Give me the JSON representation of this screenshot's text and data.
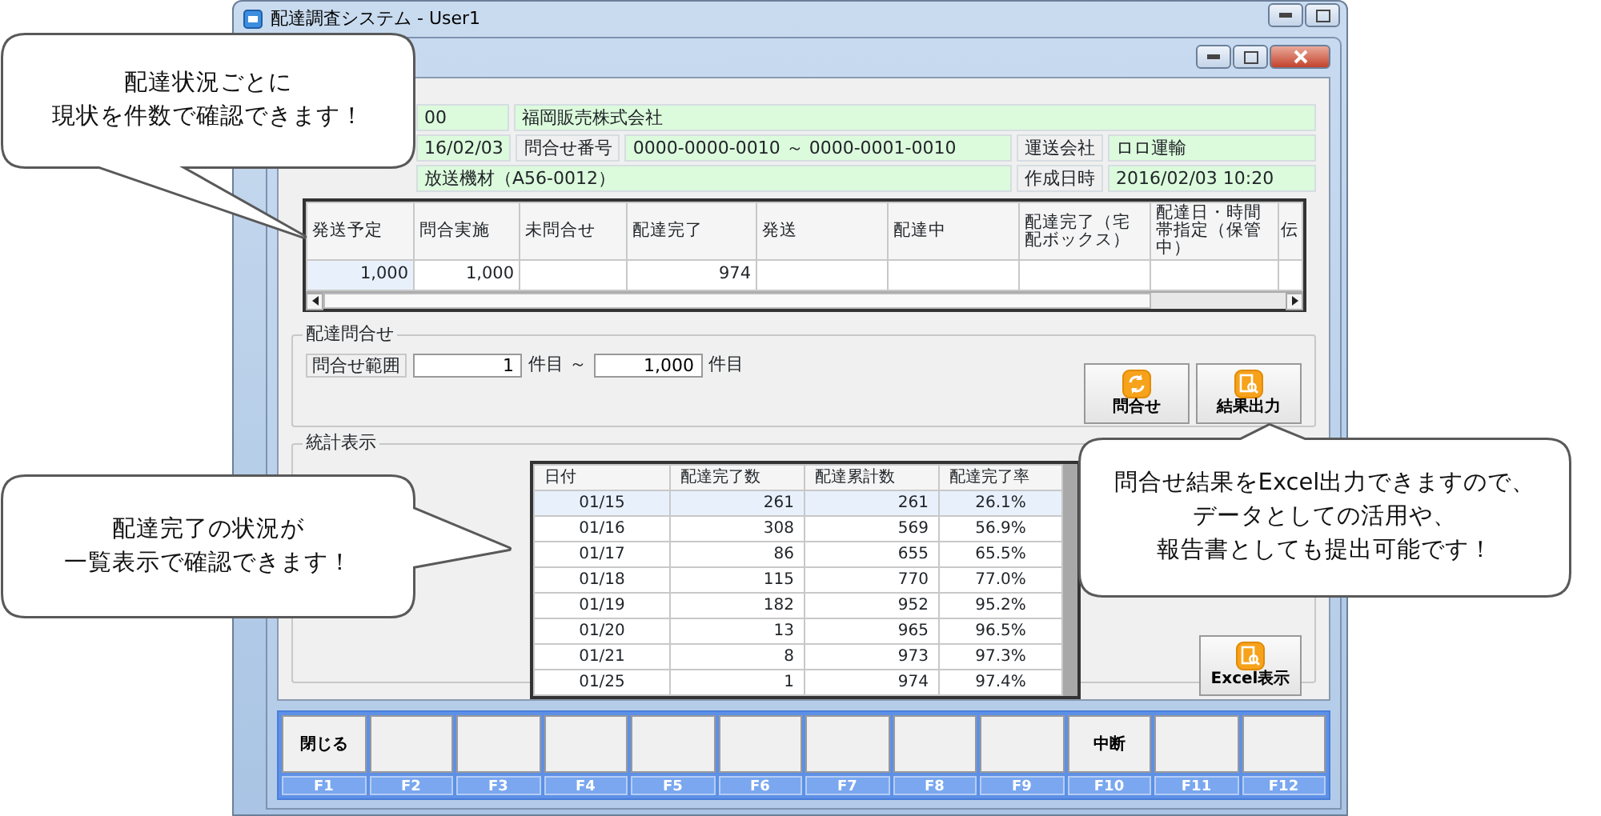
{
  "window": {
    "title": "配達調査システム - User1"
  },
  "info_rows": [
    {
      "cells": [
        {
          "kind": "value",
          "text": "00"
        },
        {
          "kind": "value",
          "text": "福岡販売株式会社"
        }
      ]
    },
    {
      "cells": [
        {
          "kind": "value",
          "text": "16/02/03"
        },
        {
          "kind": "label",
          "text": "問合せ番号"
        },
        {
          "kind": "value",
          "text": "0000-0000-0010 ～ 0000-0001-0010"
        },
        {
          "kind": "label",
          "text": "運送会社"
        },
        {
          "kind": "value",
          "text": "ロロ運輸"
        }
      ]
    },
    {
      "cells": [
        {
          "kind": "value",
          "text": "放送機材（A56-0012）"
        },
        {
          "kind": "label",
          "text": "作成日時"
        },
        {
          "kind": "value",
          "text": "2016/02/03 10:20"
        }
      ]
    }
  ],
  "status_grid": {
    "columns": [
      "発送予定",
      "問合実施",
      "未問合せ",
      "配達完了",
      "発送",
      "配達中",
      "配達完了（宅配ボックス）",
      "配達日・時間帯指定（保管中）",
      "伝"
    ],
    "row": [
      {
        "text": "1,000",
        "selected": true
      },
      {
        "text": "1,000",
        "selected": false
      },
      {
        "selected": false
      },
      {
        "text": "974",
        "selected": false
      },
      {
        "selected": false
      },
      {
        "selected": false
      },
      {
        "selected": false
      },
      {
        "selected": false
      },
      {
        "selected": false
      }
    ]
  },
  "inquiry": {
    "title": "配達問合せ",
    "range_label": "問合せ範囲",
    "from": "1",
    "from_unit": "件目 ～",
    "to": "1,000",
    "to_unit": "件目",
    "buttons": [
      {
        "label": "問合せ"
      },
      {
        "label": "結果出力"
      }
    ]
  },
  "stats": {
    "title": "統計表示",
    "columns": [
      "日付",
      "配達完了数",
      "配達累計数",
      "配達完了率"
    ],
    "rows": [
      {
        "cells": [
          "01/15",
          "261",
          "261",
          "26.1%"
        ],
        "selected": true
      },
      {
        "cells": [
          "01/16",
          "308",
          "569",
          "56.9%"
        ],
        "selected": false
      },
      {
        "cells": [
          "01/17",
          "86",
          "655",
          "65.5%"
        ],
        "selected": false
      },
      {
        "cells": [
          "01/18",
          "115",
          "770",
          "77.0%"
        ],
        "selected": false
      },
      {
        "cells": [
          "01/19",
          "182",
          "952",
          "95.2%"
        ],
        "selected": false
      },
      {
        "cells": [
          "01/20",
          "13",
          "965",
          "96.5%"
        ],
        "selected": false
      },
      {
        "cells": [
          "01/21",
          "8",
          "973",
          "97.3%"
        ],
        "selected": false
      },
      {
        "cells": [
          "01/25",
          "1",
          "974",
          "97.4%"
        ],
        "selected": false
      }
    ],
    "button": {
      "label": "Excel表示"
    }
  },
  "function_keys": [
    {
      "key": "F1",
      "label": "閉じる"
    },
    {
      "key": "F2"
    },
    {
      "key": "F3"
    },
    {
      "key": "F4"
    },
    {
      "key": "F5"
    },
    {
      "key": "F6"
    },
    {
      "key": "F7"
    },
    {
      "key": "F8"
    },
    {
      "key": "F9"
    },
    {
      "key": "F10",
      "label": "中断"
    },
    {
      "key": "F11"
    },
    {
      "key": "F12"
    }
  ],
  "callouts": [
    {
      "lines": [
        "配達状況ごとに",
        "現状を件数で確認できます！"
      ]
    },
    {
      "lines": [
        "配達完了の状況が",
        "一覧表示で確認できます！"
      ]
    },
    {
      "lines": [
        "問合せ結果をExcel出力できますので、",
        "データとしての活用や、",
        "報告書としても提出可能です！"
      ]
    }
  ]
}
